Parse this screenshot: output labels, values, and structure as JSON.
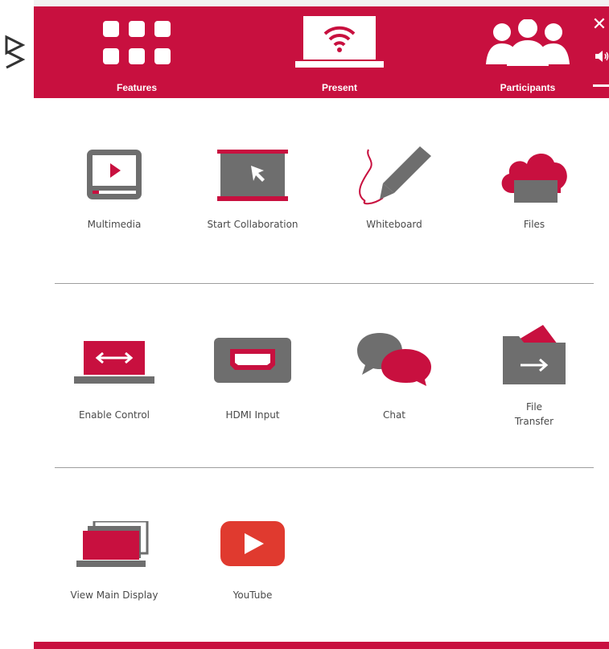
{
  "colors": {
    "brand": "#c8103f",
    "icon_gray": "#6e6e6e",
    "panel_bg": "#ffffff"
  },
  "tabs": [
    {
      "label": "Features",
      "icon": "grid-icon"
    },
    {
      "label": "Present",
      "icon": "wireless-laptop-icon"
    },
    {
      "label": "Participants",
      "icon": "people-icon"
    }
  ],
  "window_controls": {
    "close": "✕",
    "volume_icon": "volume-icon",
    "minimize_icon": "minimize-icon"
  },
  "features": {
    "row1": [
      {
        "label": "Multimedia",
        "icon": "video-player-icon"
      },
      {
        "label": "Start Collaboration",
        "icon": "collaboration-pointer-icon"
      },
      {
        "label": "Whiteboard",
        "icon": "pencil-icon"
      },
      {
        "label": "Files",
        "icon": "cloud-files-icon"
      }
    ],
    "row2": [
      {
        "label": "Enable Control",
        "icon": "laptop-arrows-icon"
      },
      {
        "label": "HDMI Input",
        "icon": "hdmi-icon"
      },
      {
        "label": "Chat",
        "icon": "chat-bubbles-icon"
      },
      {
        "label_line1": "File",
        "label_line2": "Transfer",
        "icon": "folder-arrow-icon"
      }
    ],
    "row3": [
      {
        "label": "View Main Display",
        "icon": "laptop-screens-icon"
      },
      {
        "label": "YouTube",
        "icon": "youtube-icon"
      }
    ]
  }
}
